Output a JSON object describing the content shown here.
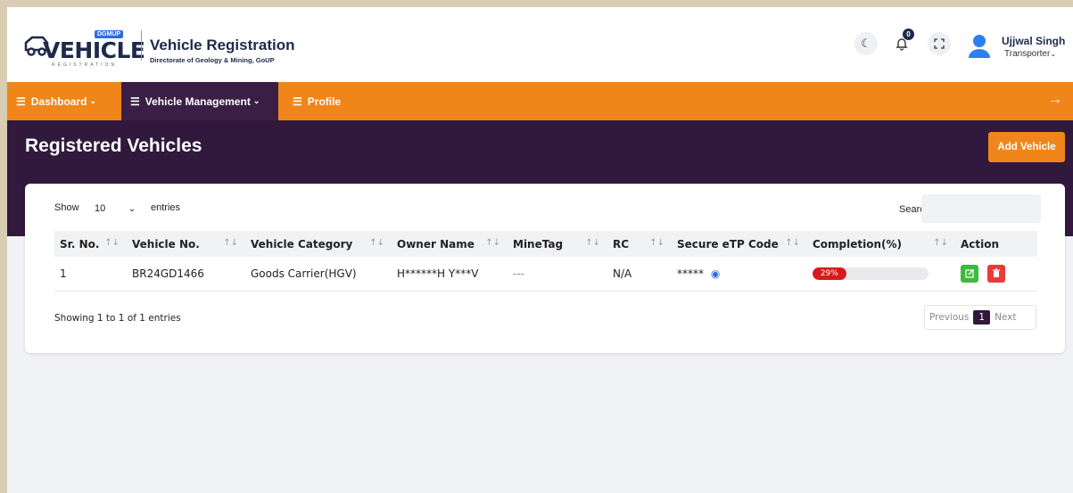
{
  "header": {
    "logo_badge": "DGMUP",
    "logo_word": "VEHICLE",
    "logo_sub": "REGISTRATION",
    "app_title": "Vehicle Registration",
    "app_subtitle": "Directorate of Geology & Mining, GoUP",
    "notification_count": "0",
    "user_name": "Ujjwal Singh",
    "user_role": "Transporter"
  },
  "nav": {
    "items": [
      {
        "label": "Dashboard"
      },
      {
        "label": "Vehicle Management"
      },
      {
        "label": "Profile"
      }
    ]
  },
  "page": {
    "title": "Registered Vehicles",
    "add_button": "Add Vehicle"
  },
  "table_controls": {
    "show_label": "Show",
    "entries_value": "10",
    "entries_label": "entries",
    "search_label": "Search:",
    "search_placeholder": ""
  },
  "table": {
    "columns": [
      "Sr. No.",
      "Vehicle No.",
      "Vehicle Category",
      "Owner Name",
      "MineTag",
      "RC",
      "Secure eTP Code",
      "Completion(%)",
      "Action"
    ],
    "rows": [
      {
        "sr_no": "1",
        "vehicle_no": "BR24GD1466",
        "category": "Goods Carrier(HGV)",
        "owner": "H******H Y***V",
        "minetag": "---",
        "rc": "N/A",
        "etp_code": "*****",
        "completion_label": "29%",
        "completion_value": 29
      }
    ]
  },
  "footer": {
    "info": "Showing 1 to 1 of 1 entries",
    "prev": "Previous",
    "page": "1",
    "next": "Next"
  },
  "colors": {
    "nav_orange": "#f08519",
    "band_purple": "#30193d",
    "progress_red": "#d91a1a",
    "edit_green": "#3dbb3d",
    "delete_red": "#ea3b3b"
  }
}
